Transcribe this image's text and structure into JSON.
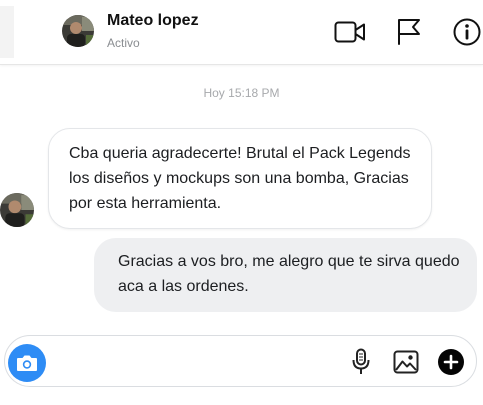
{
  "header": {
    "contact_name": "Mateo lopez",
    "contact_status": "Activo",
    "icons": [
      "video-call-icon",
      "flag-icon",
      "info-icon"
    ]
  },
  "conversation": {
    "timestamp": "Hoy 15:18 PM",
    "messages": [
      {
        "direction": "received",
        "text": "Cba queria agradecerte! Brutal el Pack Legends los diseños y mockups son una bomba, Gracias por esta herramienta."
      },
      {
        "direction": "sent",
        "text": "Gracias a vos bro, me alegro que te sirva quedo aca a las ordenes."
      }
    ]
  },
  "composer": {
    "placeholder": "",
    "icons": [
      "camera-icon",
      "microphone-icon",
      "image-icon",
      "plus-icon"
    ]
  },
  "colors": {
    "accent": "#2e8cf5",
    "sent_bubble": "#eeeff1",
    "received_bubble": "#ffffff",
    "muted_text": "#8a8d91"
  }
}
